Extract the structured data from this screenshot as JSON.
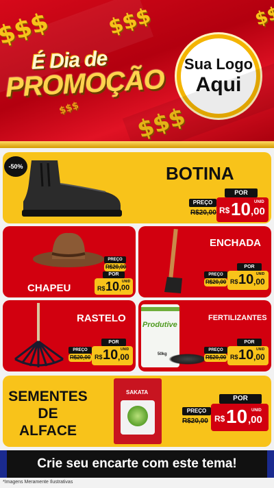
{
  "header": {
    "title_line1": "É Dia de",
    "title_line2": "PROMOÇÃO",
    "logo_line1": "Sua Logo",
    "logo_line2": "Aqui",
    "decor_symbol": "$$$"
  },
  "colors": {
    "red": "#d2000f",
    "yellow": "#f8c31a",
    "black": "#111111",
    "gold": "#f4b400"
  },
  "products": {
    "botina": {
      "name": "BOTINA",
      "badge": "-50%",
      "preco_label": "PREÇO",
      "por_label": "POR",
      "old_price": "R$20,00",
      "currency": "R$",
      "price_int": "10",
      "price_dec": ",00",
      "unit": "UNID"
    },
    "chapeu": {
      "name": "CHAPEU",
      "preco_label": "PREÇO",
      "por_label": "POR",
      "old_price": "R$20,00",
      "currency": "R$",
      "price_int": "10",
      "price_dec": ",00",
      "unit": "UNID"
    },
    "enchada": {
      "name": "ENCHADA",
      "preco_label": "PREÇO",
      "por_label": "POR",
      "old_price": "R$20,00",
      "currency": "R$",
      "price_int": "10",
      "price_dec": ",00",
      "unit": "UNID"
    },
    "rastelo": {
      "name": "RASTELO",
      "preco_label": "PREÇO",
      "por_label": "POR",
      "old_price": "R$20,00",
      "currency": "R$",
      "price_int": "10",
      "price_dec": ",00",
      "unit": "UNID"
    },
    "fertilizantes": {
      "name": "FERTILIZANTES",
      "bag_brand": "Produtive",
      "bag_weight": "50kg",
      "preco_label": "PREÇO",
      "por_label": "POR",
      "old_price": "R$20,00",
      "currency": "R$",
      "price_int": "10",
      "price_dec": ",00",
      "unit": "UNID"
    },
    "sementes": {
      "name_l1": "SEMENTES",
      "name_l2": "DE",
      "name_l3": "ALFACE",
      "packet_brand": "SAKATA",
      "preco_label": "PREÇO",
      "por_label": "POR",
      "old_price": "R$20,00",
      "currency": "R$",
      "price_int": "10",
      "price_dec": ",00",
      "unit": "UNID"
    }
  },
  "footer": {
    "cta": "Crie seu encarte com este tema!",
    "disclaimer": "*Imagens Meramente Ilustrativas"
  }
}
